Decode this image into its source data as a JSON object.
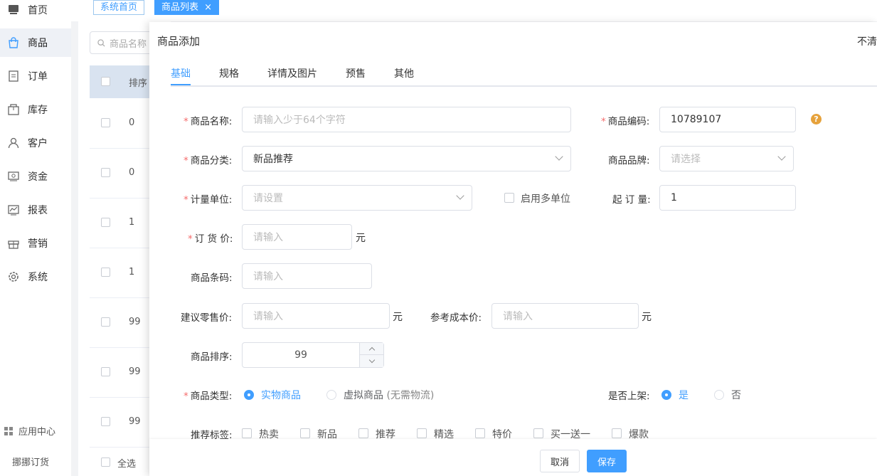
{
  "sidebar": {
    "items": [
      {
        "label": "首页",
        "icon": "home-icon"
      },
      {
        "label": "商品",
        "icon": "shopping-bag-icon"
      },
      {
        "label": "订单",
        "icon": "order-icon"
      },
      {
        "label": "库存",
        "icon": "inventory-icon"
      },
      {
        "label": "客户",
        "icon": "user-icon"
      },
      {
        "label": "资金",
        "icon": "money-icon"
      },
      {
        "label": "报表",
        "icon": "chart-icon"
      },
      {
        "label": "营销",
        "icon": "gift-icon"
      },
      {
        "label": "系统",
        "icon": "gear-icon"
      }
    ],
    "active_index": 1,
    "app_center": "应用中心",
    "brand": "挪挪订货"
  },
  "tabs": [
    {
      "label": "系统首页"
    },
    {
      "label": "商品列表"
    }
  ],
  "tab_close": "×",
  "background_list": {
    "search_placeholder": "商品名称",
    "header_col": "排序",
    "rows": [
      "0",
      "0",
      "1",
      "1",
      "99",
      "99",
      "99"
    ],
    "select_all": "全选"
  },
  "drawer": {
    "title": "商品添加",
    "close_hint": "不清",
    "tabs": [
      "基础",
      "规格",
      "详情及图片",
      "预售",
      "其他"
    ],
    "active_tab": 0
  },
  "form": {
    "name": {
      "label": "商品名称:",
      "placeholder": "请输入少于64个字符"
    },
    "code": {
      "label": "商品编码:",
      "value": "10789107",
      "help": "?"
    },
    "category": {
      "label": "商品分类:",
      "value": "新品推荐"
    },
    "brand": {
      "label": "商品品牌:",
      "placeholder": "请选择"
    },
    "unit": {
      "label": "计量单位:",
      "placeholder": "请设置"
    },
    "multi_unit": {
      "label": "启用多单位"
    },
    "min_order": {
      "label": "起 订 量:",
      "value": "1"
    },
    "order_price": {
      "label": "订 货 价:",
      "placeholder": "请输入",
      "unit": "元"
    },
    "barcode": {
      "label": "商品条码:",
      "placeholder": "请输入"
    },
    "retail_price": {
      "label": "建议零售价:",
      "placeholder": "请输入",
      "unit": "元"
    },
    "cost_price": {
      "label": "参考成本价:",
      "placeholder": "请输入",
      "unit": "元"
    },
    "sort": {
      "label": "商品排序:",
      "value": "99"
    },
    "type": {
      "label": "商品类型:",
      "options": [
        "实物商品",
        "虚拟商品"
      ],
      "virtual_note": "(无需物流)",
      "selected": 0
    },
    "on_shelf": {
      "label": "是否上架:",
      "options": [
        "是",
        "否"
      ],
      "selected": 0
    },
    "tags": {
      "label": "推荐标签:",
      "options": [
        "热卖",
        "新品",
        "推荐",
        "精选",
        "特价",
        "买一送一",
        "爆款"
      ]
    }
  },
  "footer": {
    "cancel": "取消",
    "save": "保存"
  },
  "colors": {
    "primary": "#409eff",
    "required": "#f56c6c",
    "help": "#e6a23c"
  }
}
